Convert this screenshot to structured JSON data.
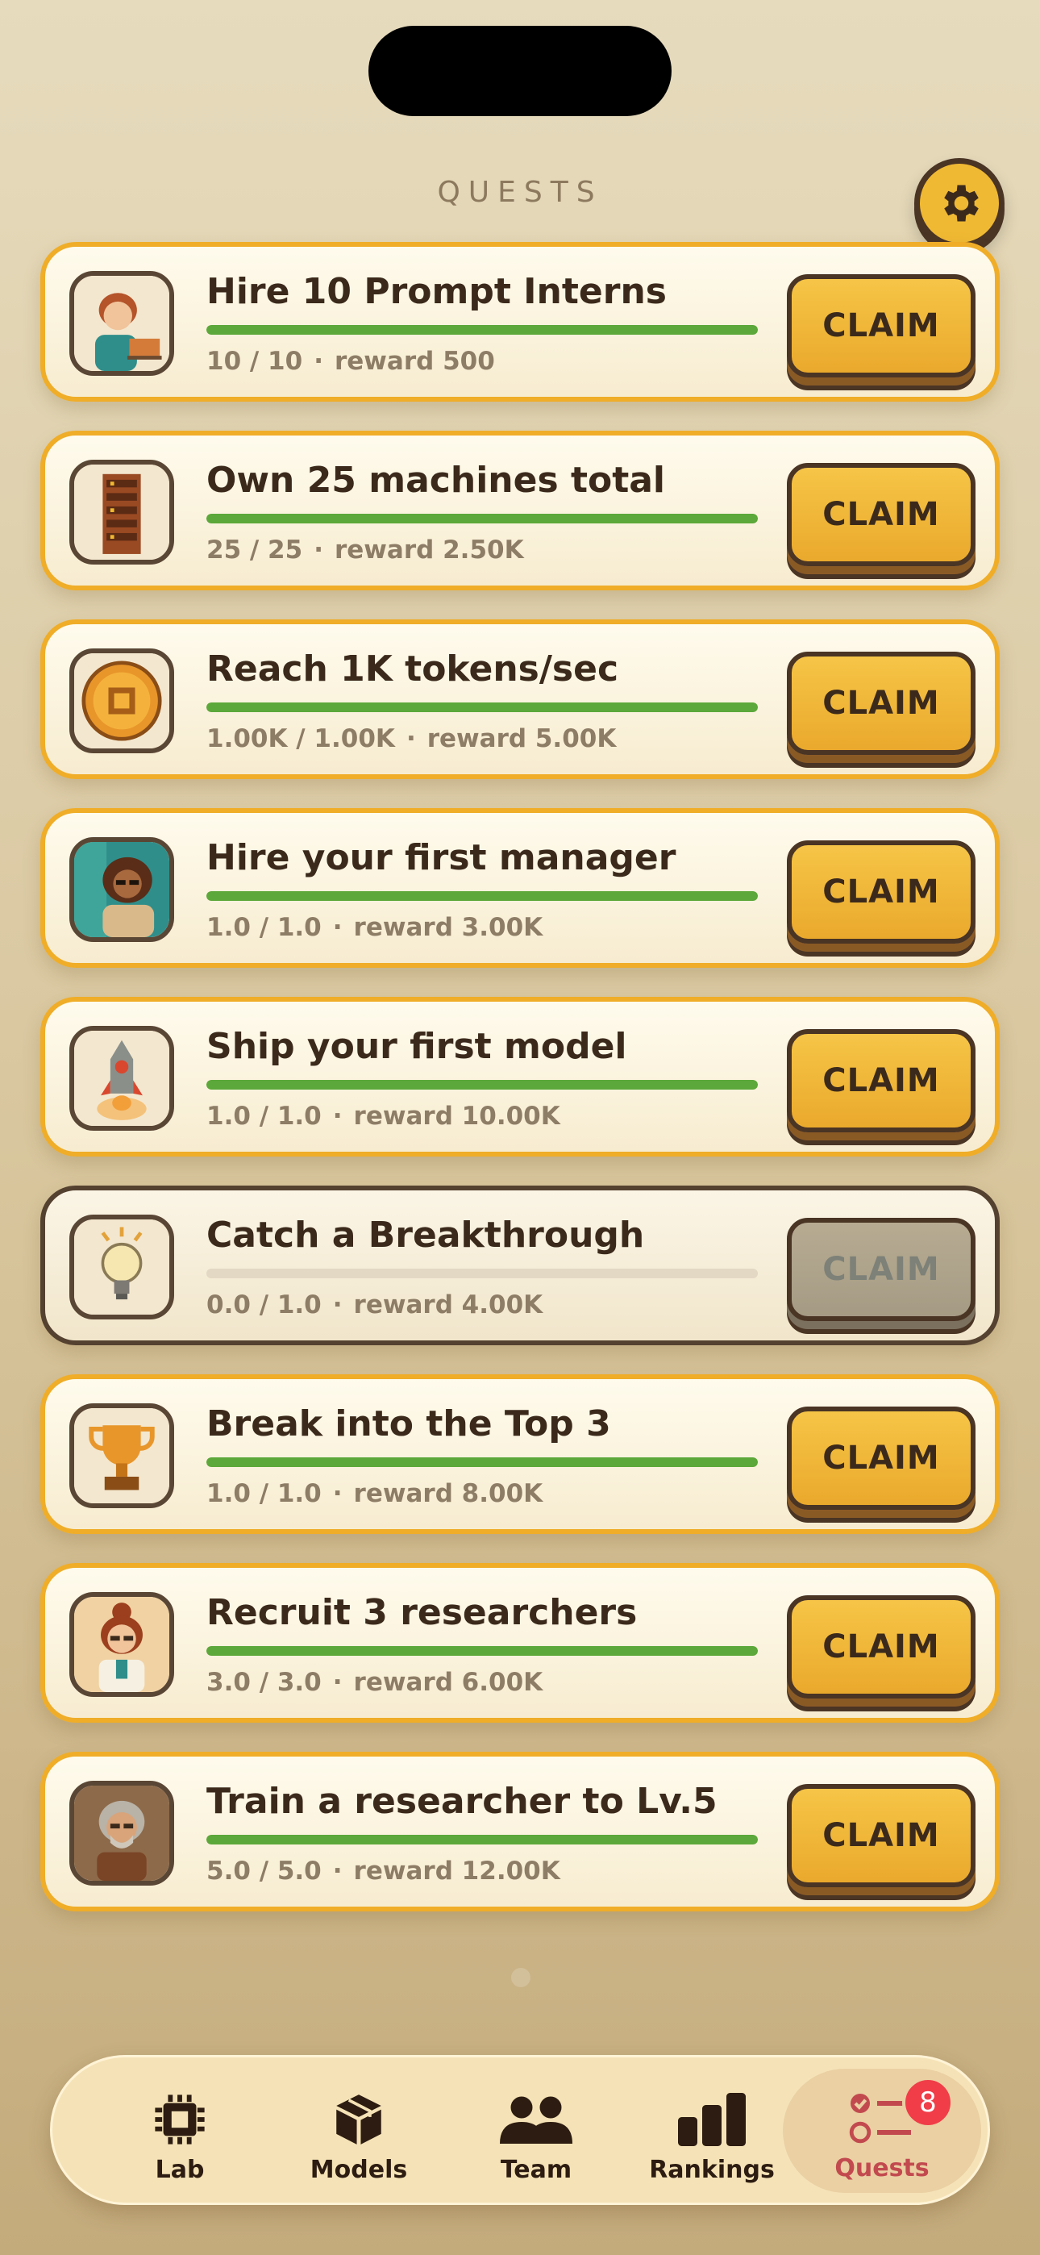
{
  "header": {
    "title": "QUESTS",
    "settings_icon": "gear-icon"
  },
  "quests": [
    {
      "title": "Hire 10 Prompt Interns",
      "progress_text": "10 / 10",
      "reward": "reward 500",
      "progress": 1.0,
      "claim_label": "CLAIM",
      "claimable": true,
      "icon": "intern-portrait-icon"
    },
    {
      "title": "Own 25 machines total",
      "progress_text": "25 / 25",
      "reward": "reward 2.50K",
      "progress": 1.0,
      "claim_label": "CLAIM",
      "claimable": true,
      "icon": "server-rack-icon"
    },
    {
      "title": "Reach 1K tokens/sec",
      "progress_text": "1.00K / 1.00K",
      "reward": "reward 5.00K",
      "progress": 1.0,
      "claim_label": "CLAIM",
      "claimable": true,
      "icon": "chip-coin-icon"
    },
    {
      "title": "Hire your first manager",
      "progress_text": "1.0 / 1.0",
      "reward": "reward 3.00K",
      "progress": 1.0,
      "claim_label": "CLAIM",
      "claimable": true,
      "icon": "manager-portrait-icon"
    },
    {
      "title": "Ship your first model",
      "progress_text": "1.0 / 1.0",
      "reward": "reward 10.00K",
      "progress": 1.0,
      "claim_label": "CLAIM",
      "claimable": true,
      "icon": "rocket-icon"
    },
    {
      "title": "Catch a Breakthrough",
      "progress_text": "0.0 / 1.0",
      "reward": "reward 4.00K",
      "progress": 0.0,
      "claim_label": "CLAIM",
      "claimable": false,
      "icon": "lightbulb-icon"
    },
    {
      "title": "Break into the Top 3",
      "progress_text": "1.0 / 1.0",
      "reward": "reward 8.00K",
      "progress": 1.0,
      "claim_label": "CLAIM",
      "claimable": true,
      "icon": "trophy-icon"
    },
    {
      "title": "Recruit 3 researchers",
      "progress_text": "3.0 / 3.0",
      "reward": "reward 6.00K",
      "progress": 1.0,
      "claim_label": "CLAIM",
      "claimable": true,
      "icon": "researcher-portrait-icon"
    },
    {
      "title": "Train a researcher to Lv.5",
      "progress_text": "5.0 / 5.0",
      "reward": "reward 12.00K",
      "progress": 1.0,
      "claim_label": "CLAIM",
      "claimable": true,
      "icon": "senior-researcher-portrait-icon"
    }
  ],
  "tabs": [
    {
      "label": "Lab",
      "icon": "chip-icon",
      "active": false
    },
    {
      "label": "Models",
      "icon": "cube-icon",
      "active": false
    },
    {
      "label": "Team",
      "icon": "people-icon",
      "active": false
    },
    {
      "label": "Rankings",
      "icon": "bar-chart-icon",
      "active": false
    },
    {
      "label": "Quests",
      "icon": "checklist-icon",
      "active": true,
      "badge": "8"
    }
  ],
  "colors": {
    "accent_gold": "#efad28",
    "progress_green": "#5ca83a",
    "badge_red": "#f03d48",
    "active_tab_text": "#c24a4f"
  }
}
